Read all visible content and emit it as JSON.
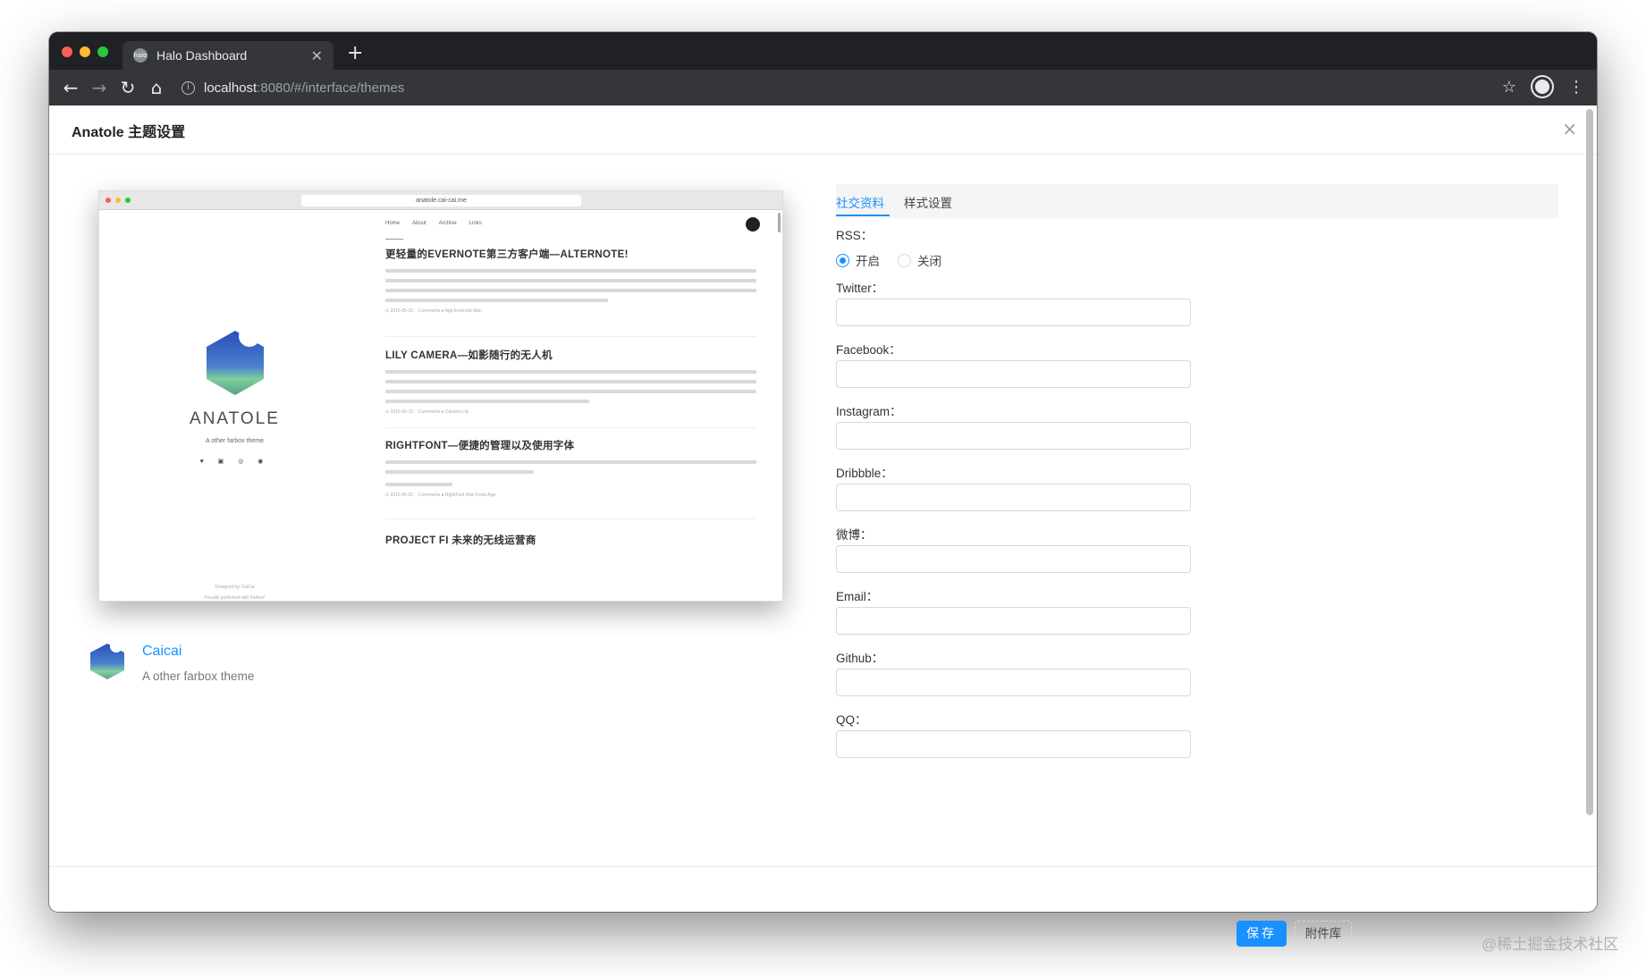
{
  "browser": {
    "tab_title": "Halo Dashboard",
    "tab_favicon_text": "halo",
    "new_tab": "+",
    "url_host": "localhost",
    "url_path": ":8080/#/interface/themes",
    "icons": [
      "back-icon",
      "forward-icon",
      "reload-icon",
      "home-icon",
      "info-icon",
      "bookmark-star-icon",
      "profile-icon",
      "menu-dots-icon"
    ]
  },
  "modal": {
    "title": "Anatole 主题设置",
    "close": "×"
  },
  "preview": {
    "url": "anatole.cai-cai.me",
    "site_name": "ANATOLE",
    "site_tagline": "A other farbox theme",
    "social_icons": "♥ ▣ ◎ ◉",
    "nav": [
      "Home",
      "About",
      "Archive",
      "Links"
    ],
    "footer_1": "Designed by CaiCai",
    "footer_2": "Proudly published with Farbox!",
    "posts": [
      {
        "title": "更轻量的EVERNOTE第三方客户端—ALTERNOTE!",
        "meta": "⊙ 2015-05-22  ◌ Comments  ● App  Evernote  Mac"
      },
      {
        "title": "LILY CAMERA—如影随行的无人机",
        "meta": "⊙ 2015-05-12  ◌ Comments  ● Camera  Lily"
      },
      {
        "title": "RIGHTFONT—便捷的管理以及使用字体",
        "meta": "⊙ 2015-05-02  ◌ Comments  ● RightFont  Mac  Fonts  App"
      },
      {
        "title": "PROJECT FI 未来的无线运营商",
        "meta": ""
      }
    ]
  },
  "theme": {
    "author": "Caicai",
    "description": "A other farbox theme"
  },
  "settings": {
    "tabs": [
      "社交资料",
      "样式设置"
    ],
    "active_tab": 0,
    "rss_label": "RSS：",
    "rss_on": "开启",
    "rss_off": "关闭",
    "rss_value": "开启",
    "fields": [
      {
        "label": "Twitter：",
        "value": ""
      },
      {
        "label": "Facebook：",
        "value": ""
      },
      {
        "label": "Instagram：",
        "value": ""
      },
      {
        "label": "Dribbble：",
        "value": ""
      },
      {
        "label": "微博：",
        "value": ""
      },
      {
        "label": "Email：",
        "value": ""
      },
      {
        "label": "Github：",
        "value": ""
      },
      {
        "label": "QQ：",
        "value": ""
      }
    ]
  },
  "footer": {
    "save": "保存",
    "attachments": "附件库"
  },
  "watermark": "@稀土掘金技术社区",
  "colors": {
    "accent": "#1890ff",
    "chrome_dark": "#202124",
    "chrome_toolbar": "#35363a"
  }
}
